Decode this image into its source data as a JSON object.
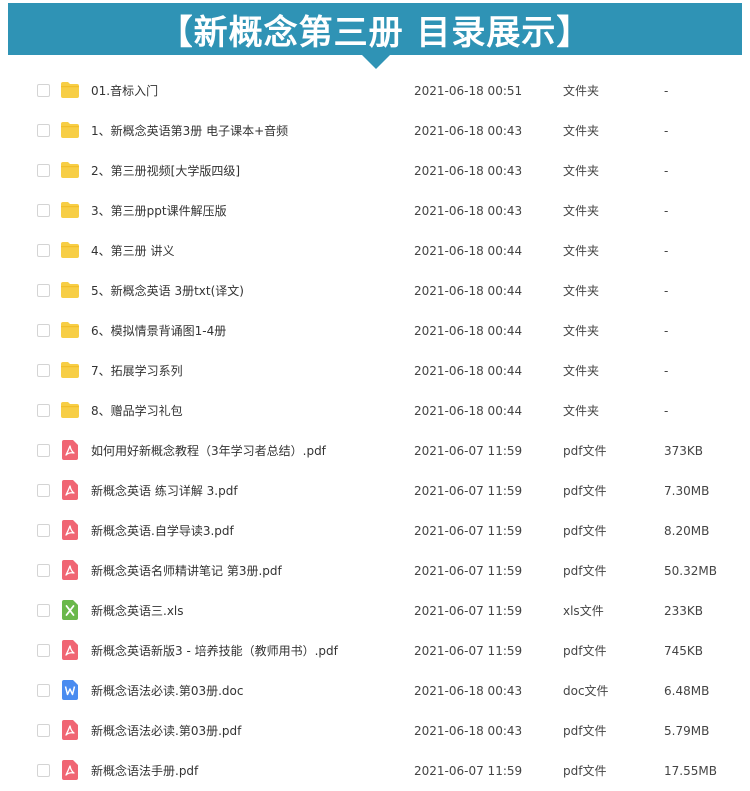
{
  "banner": {
    "title": "【新概念第三册 目录展示】"
  },
  "colors": {
    "banner_bg": "#2f93b5",
    "folder": "#f7ce46",
    "pdf": "#f06573",
    "xls": "#6ab84b",
    "doc": "#4a8cf0"
  },
  "files": [
    {
      "name": "01.音标入门",
      "date": "2021-06-18 00:51",
      "type": "文件夹",
      "size": "-",
      "icon": "folder-icon"
    },
    {
      "name": "1、新概念英语第3册 电子课本+音频",
      "date": "2021-06-18 00:43",
      "type": "文件夹",
      "size": "-",
      "icon": "folder-icon"
    },
    {
      "name": "2、第三册视频[大学版四级]",
      "date": "2021-06-18 00:43",
      "type": "文件夹",
      "size": "-",
      "icon": "folder-icon"
    },
    {
      "name": "3、第三册ppt课件解压版",
      "date": "2021-06-18 00:43",
      "type": "文件夹",
      "size": "-",
      "icon": "folder-icon"
    },
    {
      "name": "4、第三册 讲义",
      "date": "2021-06-18 00:44",
      "type": "文件夹",
      "size": "-",
      "icon": "folder-icon"
    },
    {
      "name": "5、新概念英语 3册txt(译文)",
      "date": "2021-06-18 00:44",
      "type": "文件夹",
      "size": "-",
      "icon": "folder-icon"
    },
    {
      "name": "6、模拟情景背诵图1-4册",
      "date": "2021-06-18 00:44",
      "type": "文件夹",
      "size": "-",
      "icon": "folder-icon"
    },
    {
      "name": "7、拓展学习系列",
      "date": "2021-06-18 00:44",
      "type": "文件夹",
      "size": "-",
      "icon": "folder-icon"
    },
    {
      "name": "8、赠品学习礼包",
      "date": "2021-06-18 00:44",
      "type": "文件夹",
      "size": "-",
      "icon": "folder-icon"
    },
    {
      "name": "如何用好新概念教程（3年学习者总结）.pdf",
      "date": "2021-06-07 11:59",
      "type": "pdf文件",
      "size": "373KB",
      "icon": "pdf-icon"
    },
    {
      "name": "新概念英语 练习详解 3.pdf",
      "date": "2021-06-07 11:59",
      "type": "pdf文件",
      "size": "7.30MB",
      "icon": "pdf-icon"
    },
    {
      "name": "新概念英语.自学导读3.pdf",
      "date": "2021-06-07 11:59",
      "type": "pdf文件",
      "size": "8.20MB",
      "icon": "pdf-icon"
    },
    {
      "name": "新概念英语名师精讲笔记 第3册.pdf",
      "date": "2021-06-07 11:59",
      "type": "pdf文件",
      "size": "50.32MB",
      "icon": "pdf-icon"
    },
    {
      "name": "新概念英语三.xls",
      "date": "2021-06-07 11:59",
      "type": "xls文件",
      "size": "233KB",
      "icon": "xls-icon"
    },
    {
      "name": "新概念英语新版3 - 培养技能（教师用书）.pdf",
      "date": "2021-06-07 11:59",
      "type": "pdf文件",
      "size": "745KB",
      "icon": "pdf-icon"
    },
    {
      "name": "新概念语法必读.第03册.doc",
      "date": "2021-06-18 00:43",
      "type": "doc文件",
      "size": "6.48MB",
      "icon": "doc-icon"
    },
    {
      "name": "新概念语法必读.第03册.pdf",
      "date": "2021-06-18 00:43",
      "type": "pdf文件",
      "size": "5.79MB",
      "icon": "pdf-icon"
    },
    {
      "name": "新概念语法手册.pdf",
      "date": "2021-06-07 11:59",
      "type": "pdf文件",
      "size": "17.55MB",
      "icon": "pdf-icon"
    }
  ]
}
